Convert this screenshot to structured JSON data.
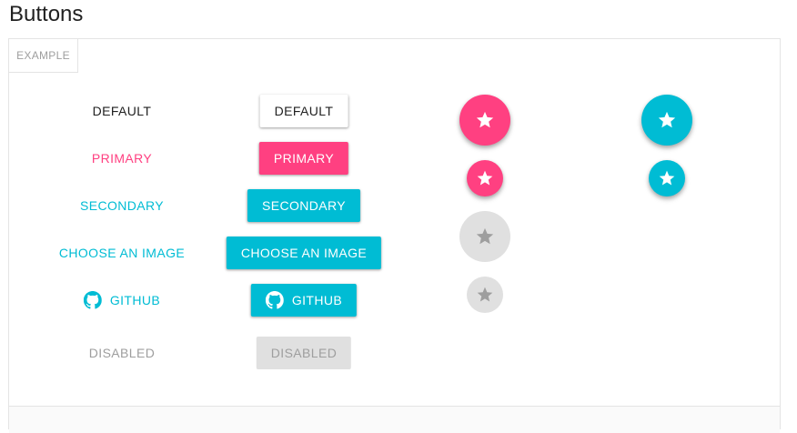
{
  "page": {
    "title": "Buttons"
  },
  "example": {
    "tab_label": "EXAMPLE"
  },
  "buttons": {
    "default": "DEFAULT",
    "primary": "PRIMARY",
    "secondary": "SECONDARY",
    "choose_image": "CHOOSE AN IMAGE",
    "github": "GITHUB",
    "disabled": "DISABLED"
  },
  "icons": {
    "github": "github-icon",
    "fab": "star-icon"
  },
  "colors": {
    "primary": "#ff4081",
    "secondary": "#00bcd4",
    "disabled_bg": "#e0e0e0",
    "disabled_text": "#9e9e9e",
    "text": "#212121"
  }
}
